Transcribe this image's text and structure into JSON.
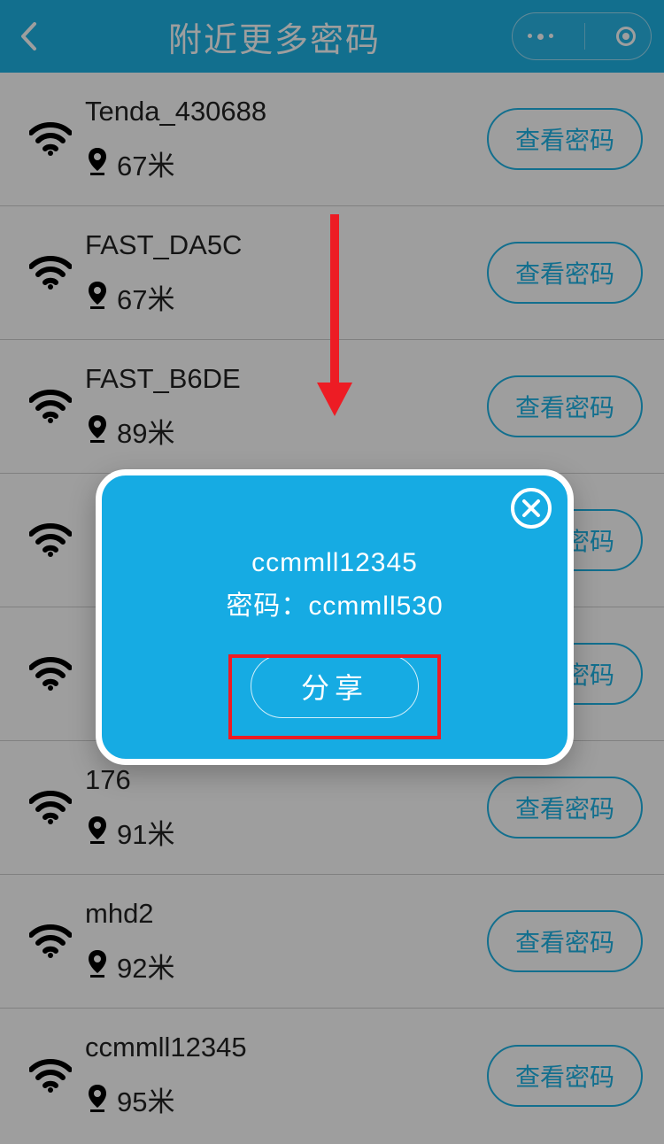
{
  "header": {
    "title": "附近更多密码"
  },
  "buttons": {
    "view_password": "查看密码",
    "share": "分享"
  },
  "wifi_list": [
    {
      "ssid": "Tenda_430688",
      "distance": "67米"
    },
    {
      "ssid": "FAST_DA5C",
      "distance": "67米"
    },
    {
      "ssid": "FAST_B6DE",
      "distance": "89米"
    },
    {
      "ssid": "",
      "distance": ""
    },
    {
      "ssid": "",
      "distance": ""
    },
    {
      "ssid": "176",
      "distance": "91米"
    },
    {
      "ssid": "mhd2",
      "distance": "92米"
    },
    {
      "ssid": "ccmmll12345",
      "distance": "95米"
    }
  ],
  "modal": {
    "ssid": "ccmmll12345",
    "password_label": "密码：",
    "password": "ccmmll530"
  }
}
